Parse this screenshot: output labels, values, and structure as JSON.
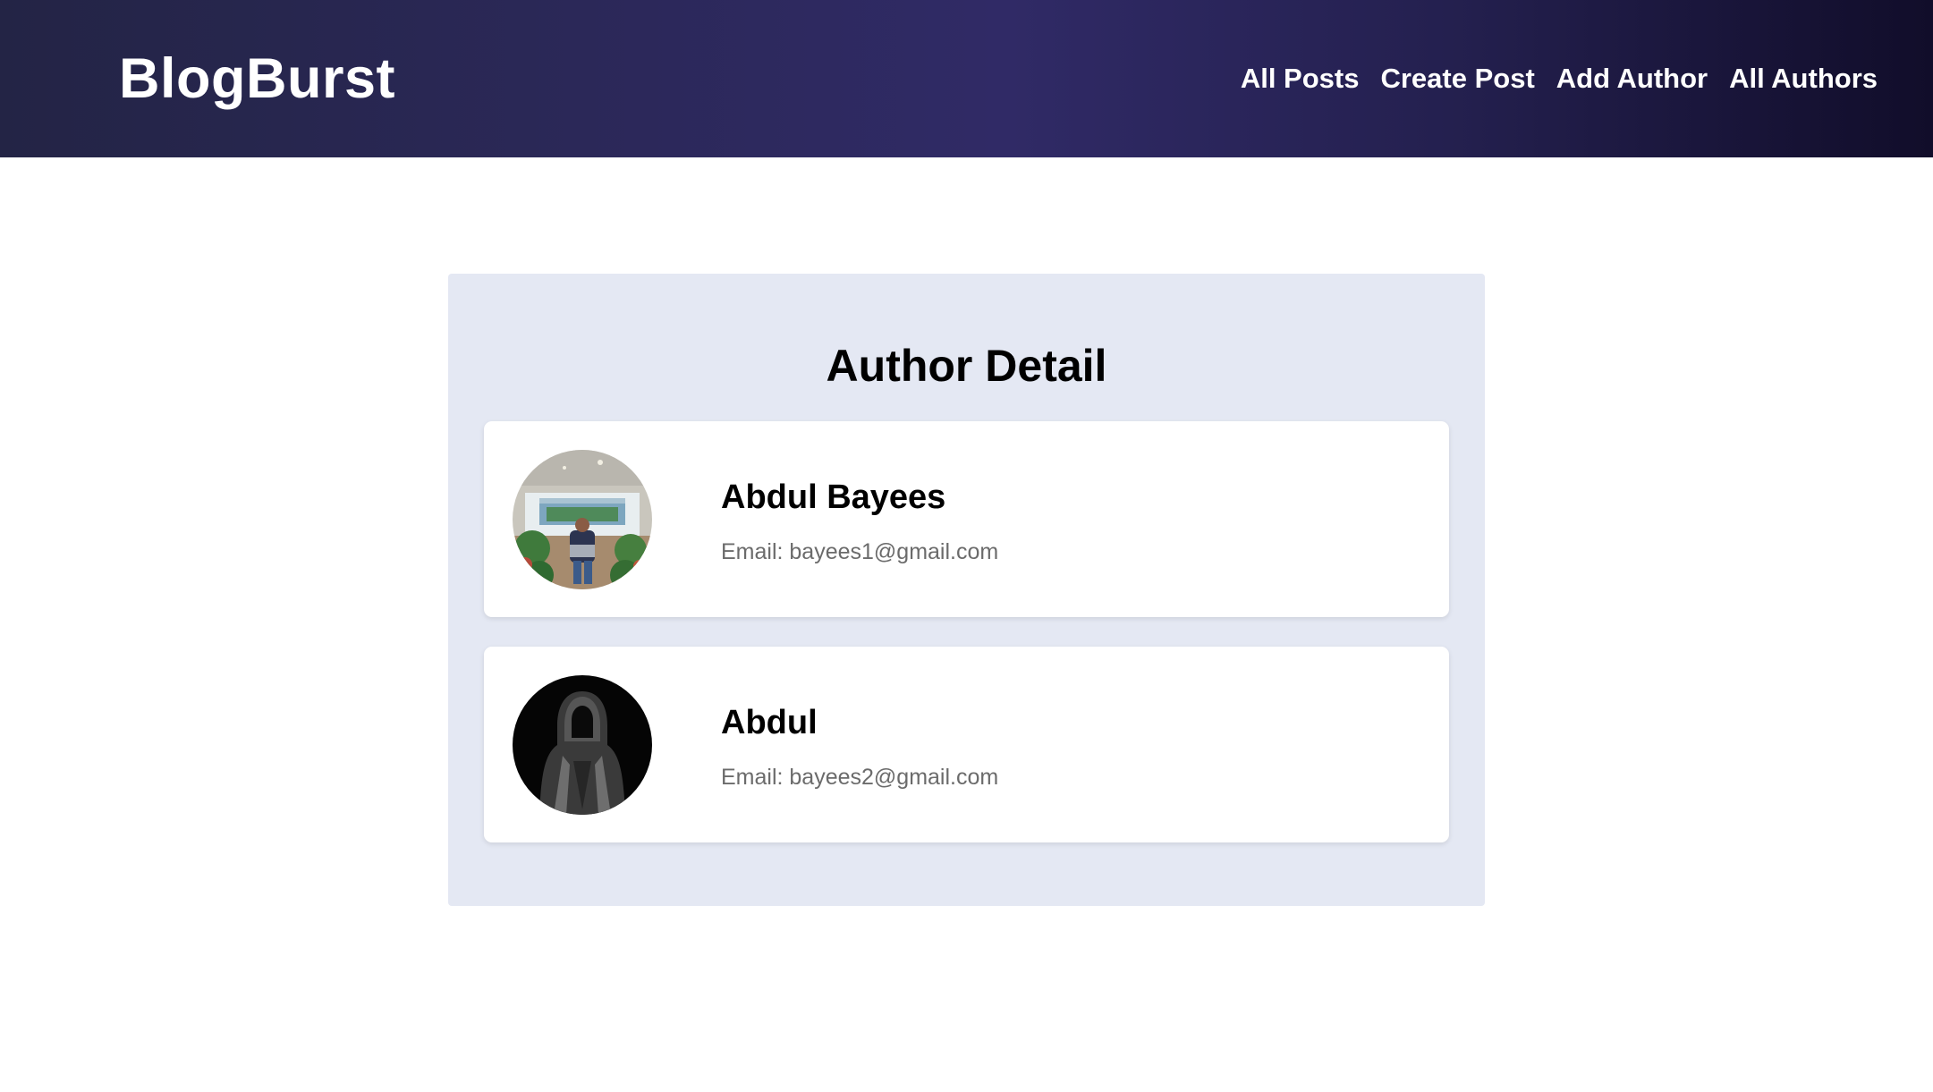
{
  "brand": "BlogBurst",
  "nav": {
    "links": [
      "All Posts",
      "Create Post",
      "Add Author",
      "All Authors"
    ]
  },
  "page": {
    "title": "Author Detail"
  },
  "authors": [
    {
      "name": "Abdul Bayees",
      "email": "Email: bayees1@gmail.com",
      "avatar": "author-photo-indoor"
    },
    {
      "name": "Abdul",
      "email": "Email: bayees2@gmail.com",
      "avatar": "hooded-figure-photo"
    }
  ],
  "colors": {
    "nav_start": "#232445",
    "nav_mid": "#302a66",
    "nav_end": "#110d2a",
    "panel_bg": "#e4e8f3",
    "email_text": "#6b6b6b"
  }
}
